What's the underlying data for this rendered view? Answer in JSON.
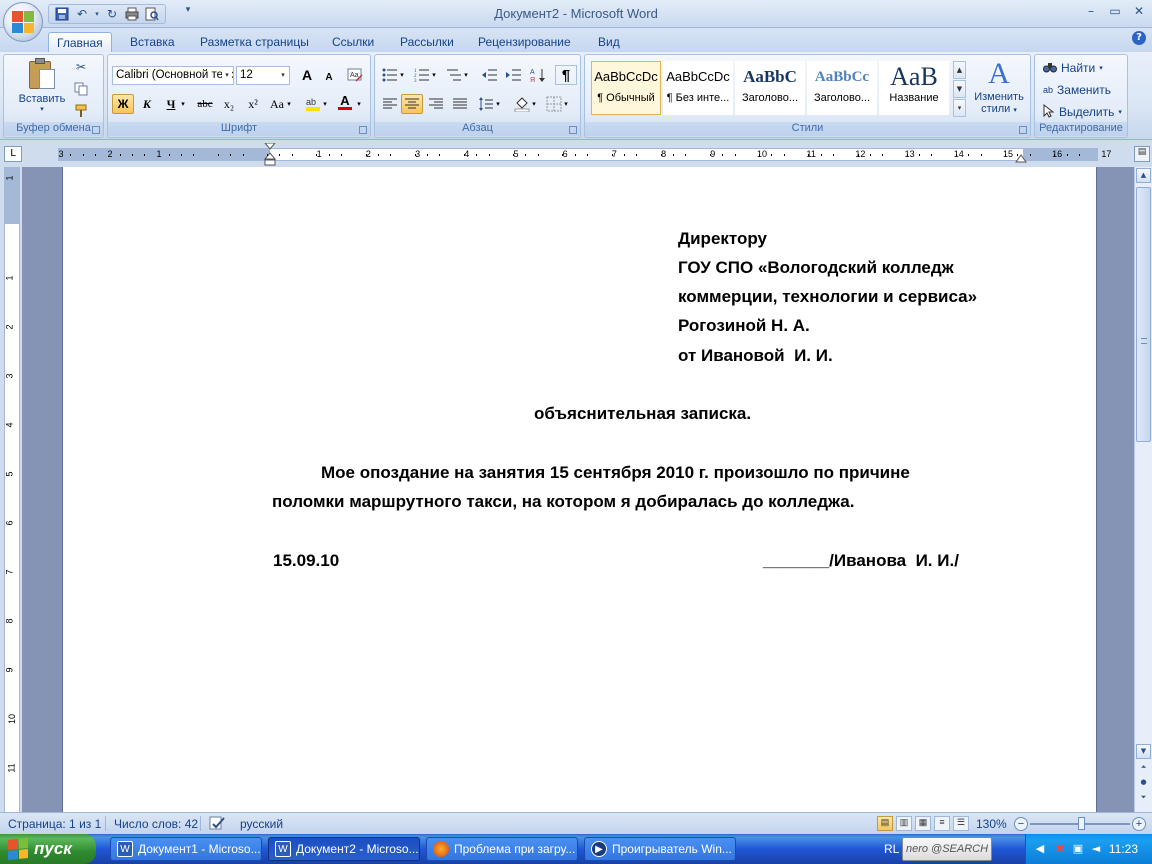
{
  "window": {
    "title": "Документ2 - Microsoft Word",
    "minimize": "–",
    "maximize": "▭",
    "close": "✕"
  },
  "ribbon_tabs": [
    "Главная",
    "Вставка",
    "Разметка страницы",
    "Ссылки",
    "Рассылки",
    "Рецензирование",
    "Вид"
  ],
  "clipboard": {
    "paste_label": "Вставить",
    "group_label": "Буфер обмена"
  },
  "font": {
    "font_name": "Calibri (Основной текст)",
    "font_size": "12",
    "group_label": "Шрифт",
    "bold": "Ж",
    "italic": "К",
    "underline": "Ч",
    "strike": "abc",
    "subscript": "x₂",
    "superscript": "x²",
    "case": "Aa",
    "grow": "A",
    "shrink": "A",
    "color_letter": "A"
  },
  "paragraph": {
    "group_label": "Абзац",
    "pilcrow": "¶"
  },
  "styles": {
    "group_label": "Стили",
    "items": [
      {
        "sample": "AaBbCcDc",
        "name": "¶ Обычный"
      },
      {
        "sample": "AaBbCcDc",
        "name": "¶ Без инте..."
      },
      {
        "sample": "AaBbC",
        "name": "Заголово..."
      },
      {
        "sample": "AaBbCc",
        "name": "Заголово..."
      },
      {
        "sample": "AaB",
        "name": "Название"
      }
    ],
    "change_styles_line1": "Изменить",
    "change_styles_line2": "стили"
  },
  "editing": {
    "group_label": "Редактирование",
    "find": "Найти",
    "replace": "Заменить",
    "select": "Выделить"
  },
  "ruler": {
    "tab_selector": "L",
    "left_numbers": [
      "3",
      "2",
      "1"
    ],
    "numbers": [
      "1",
      "2",
      "3",
      "4",
      "5",
      "6",
      "7",
      "8",
      "9",
      "10",
      "11",
      "12",
      "13",
      "14",
      "15",
      "16",
      "17"
    ],
    "vertical_numbers": [
      "1",
      "1",
      "2",
      "3",
      "4",
      "5",
      "6",
      "7",
      "8",
      "9",
      "10",
      "11"
    ]
  },
  "document": {
    "addressee": [
      "Директору",
      "ГОУ СПО «Вологодский колледж",
      "коммерции, технологии и сервиса»",
      "Рогозиной Н. А.",
      "от Ивановой  И. И."
    ],
    "heading": "объяснительная записка.",
    "body_line1": "Мое опоздание на занятия 15 сентября 2010 г. произошло по причине",
    "body_line2": "поломки маршрутного такси, на котором я добиралась до колледжа.",
    "date": "15.09.10",
    "signature": "_______/Иванова  И. И./"
  },
  "statusbar": {
    "page": "Страница: 1 из 1",
    "words": "Число слов: 42",
    "language": "русский",
    "zoom": "130%",
    "zoom_minus": "−",
    "zoom_plus": "+"
  },
  "taskbar": {
    "start": "пуск",
    "tasks": [
      {
        "label": "Документ1 - Microso...",
        "icon": "word-icon"
      },
      {
        "label": "Документ2 - Microso...",
        "icon": "word-icon"
      },
      {
        "label": "Проблема при загру...",
        "icon": "firefox-icon"
      },
      {
        "label": "Проигрыватель Win...",
        "icon": "media-player-icon"
      }
    ],
    "language": "RL",
    "search_widget": "nero @SEARCH",
    "clock": "11:23"
  },
  "colors": {
    "ribbon_text": "#15428b",
    "taskbar_blue": "#2157d7",
    "start_green": "#3c9a3c",
    "page_bg": "#ffffff",
    "workspace_bg": "#8593b5"
  }
}
